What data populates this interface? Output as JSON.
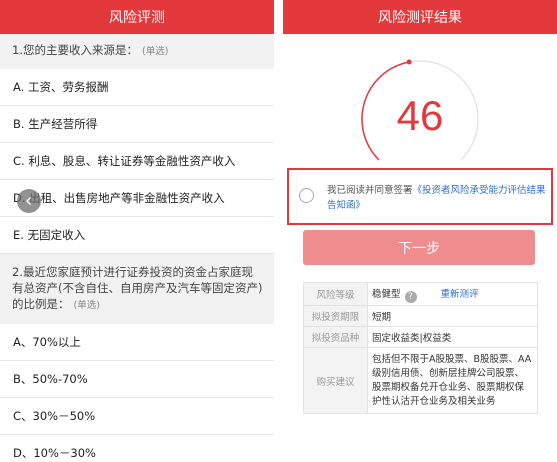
{
  "left": {
    "title": "风险评测",
    "q1": {
      "text": "1.您的主要收入来源是：",
      "hint": "(单选)",
      "options": [
        "A. 工资、劳务报酬",
        "B. 生产经营所得",
        "C. 利息、股息、转让证券等金融性资产收入",
        "D. 出租、出售房地产等非金融性资产收入",
        "E. 无固定收入"
      ]
    },
    "q2": {
      "text": "2.最近您家庭预计进行证券投资的资金占家庭现有总资产(不含自住、自用房产及汽车等固定资产)的比例是：",
      "hint": "(单选)",
      "options": [
        "A、70%以上",
        "B、50%-70%",
        "C、30%－50%",
        "D、10%－30%"
      ]
    },
    "back_icon": "chevron-left-icon"
  },
  "right": {
    "title": "风险测评结果",
    "score": "46",
    "gauge_fraction": 0.46,
    "agree": {
      "prefix": "我已阅读并同意签署",
      "link": "《投资者风险承受能力评估结果告知函》"
    },
    "next_label": "下一步",
    "table": {
      "level_label": "风险等级",
      "level_value": "稳健型",
      "retest": "重新测评",
      "term_label": "拟投资期限",
      "term_value": "短期",
      "type_label": "拟投资品种",
      "type_value": "固定收益类|权益类",
      "advice_label": "购买建议",
      "advice_value": "包括但不限于A股股票、B股股票、AA级别信用债、创新层挂牌公司股票、股票期权备兑开仓业务、股票期权保护性认沽开仓业务及相关业务"
    }
  },
  "colors": {
    "accent": "#e4393c",
    "button_disabled": "#ef8c8e",
    "link": "#2f6fd1"
  }
}
